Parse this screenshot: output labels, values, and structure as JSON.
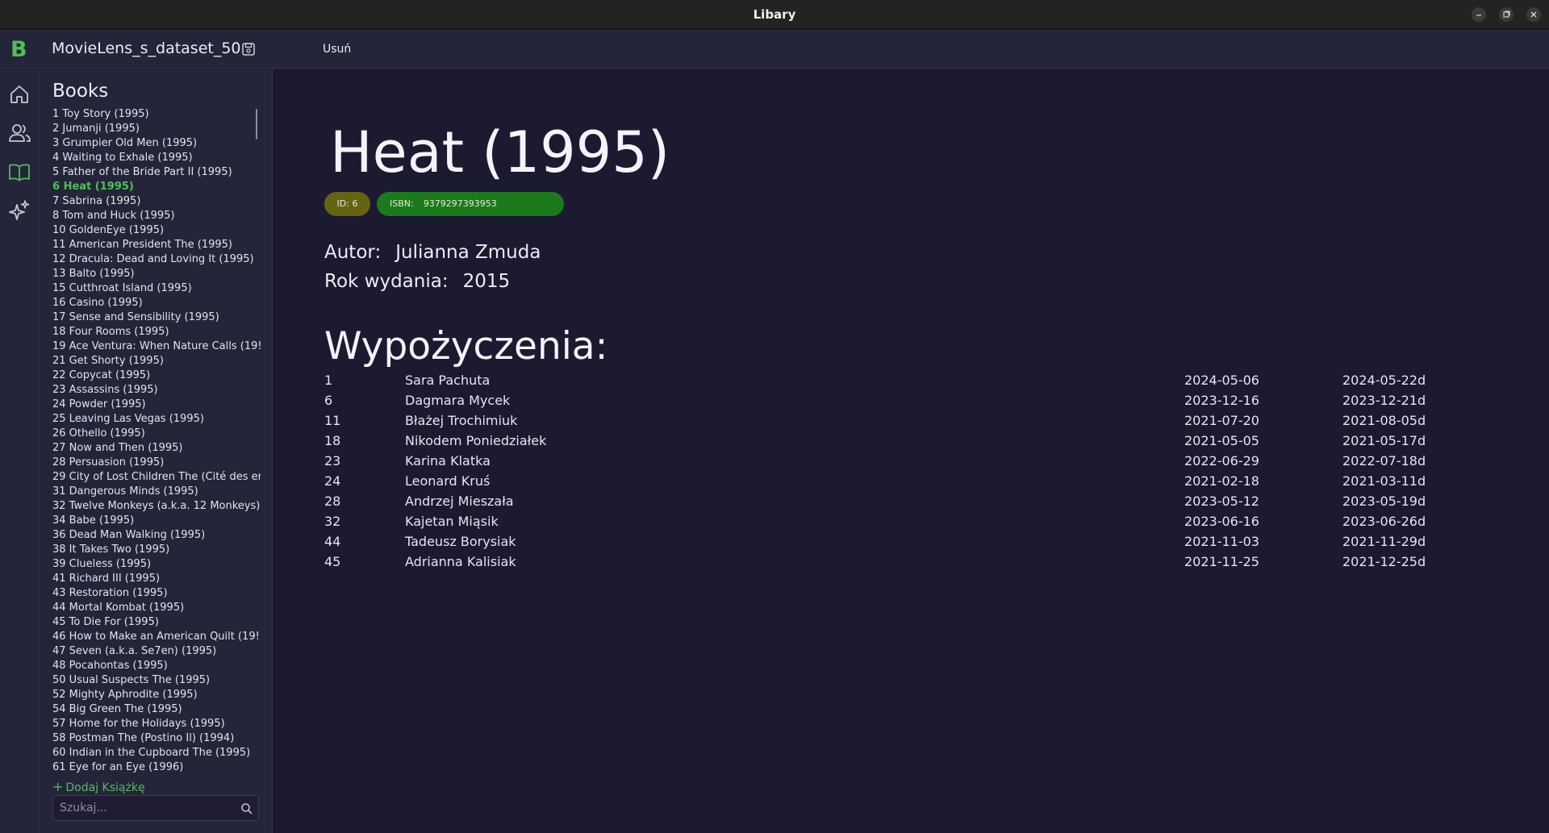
{
  "window": {
    "title": "Libary"
  },
  "header": {
    "logo": "B",
    "dataset_name": "MovieLens_s_dataset_50",
    "delete_label": "Usuń"
  },
  "sidebar": {
    "title": "Books",
    "add_label": "Dodaj Książkę",
    "search_placeholder": "Szukaj...",
    "active_index": 5,
    "books": [
      "1 Toy Story (1995)",
      "2 Jumanji (1995)",
      "3 Grumpier Old Men (1995)",
      "4 Waiting to Exhale (1995)",
      "5 Father of the Bride Part II (1995)",
      "6 Heat (1995)",
      "7 Sabrina (1995)",
      "8 Tom and Huck (1995)",
      "10 GoldenEye (1995)",
      "11 American President The (1995)",
      "12 Dracula: Dead and Loving It (1995)",
      "13 Balto (1995)",
      "15 Cutthroat Island (1995)",
      "16 Casino (1995)",
      "17 Sense and Sensibility (1995)",
      "18 Four Rooms (1995)",
      "19 Ace Ventura: When Nature Calls (19!",
      "21 Get Shorty (1995)",
      "22 Copycat (1995)",
      "23 Assassins (1995)",
      "24 Powder (1995)",
      "25 Leaving Las Vegas (1995)",
      "26 Othello (1995)",
      "27 Now and Then (1995)",
      "28 Persuasion (1995)",
      "29 City of Lost Children The (Cité des er",
      "31 Dangerous Minds (1995)",
      "32 Twelve Monkeys (a.k.a. 12 Monkeys)",
      "34 Babe (1995)",
      "36 Dead Man Walking (1995)",
      "38 It Takes Two (1995)",
      "39 Clueless (1995)",
      "41 Richard III (1995)",
      "43 Restoration (1995)",
      "44 Mortal Kombat (1995)",
      "45 To Die For (1995)",
      "46 How to Make an American Quilt (19!",
      "47 Seven (a.k.a. Se7en) (1995)",
      "48 Pocahontas (1995)",
      "50 Usual Suspects The (1995)",
      "52 Mighty Aphrodite (1995)",
      "54 Big Green The (1995)",
      "57 Home for the Holidays (1995)",
      "58 Postman The (Postino Il) (1994)",
      "60 Indian in the Cupboard The (1995)",
      "61 Eye for an Eye (1996)"
    ]
  },
  "book": {
    "title": "Heat (1995)",
    "id_badge": "ID: 6",
    "isbn_label": "ISBN:",
    "isbn_value": "9379297393953",
    "author_label": "Autor:",
    "author_value": "Julianna Zmuda",
    "year_label": "Rok wydania:",
    "year_value": "2015"
  },
  "loans": {
    "title": "Wypożyczenia:",
    "rows": [
      {
        "id": "1",
        "name": "Sara Pachuta",
        "from": "2024-05-06",
        "to": "2024-05-22d"
      },
      {
        "id": "6",
        "name": "Dagmara Mycek",
        "from": "2023-12-16",
        "to": "2023-12-21d"
      },
      {
        "id": "11",
        "name": "Błażej Trochimiuk",
        "from": "2021-07-20",
        "to": "2021-08-05d"
      },
      {
        "id": "18",
        "name": "Nikodem Poniedziałek",
        "from": "2021-05-05",
        "to": "2021-05-17d"
      },
      {
        "id": "23",
        "name": "Karina Klatka",
        "from": "2022-06-29",
        "to": "2022-07-18d"
      },
      {
        "id": "24",
        "name": "Leonard Kruś",
        "from": "2021-02-18",
        "to": "2021-03-11d"
      },
      {
        "id": "28",
        "name": "Andrzej Mieszała",
        "from": "2023-05-12",
        "to": "2023-05-19d"
      },
      {
        "id": "32",
        "name": "Kajetan Miąsik",
        "from": "2023-06-16",
        "to": "2023-06-26d"
      },
      {
        "id": "44",
        "name": "Tadeusz Borysiak",
        "from": "2021-11-03",
        "to": "2021-11-29d"
      },
      {
        "id": "45",
        "name": "Adrianna Kalisiak",
        "from": "2021-11-25",
        "to": "2021-12-25d"
      }
    ]
  },
  "icons": {
    "rail": [
      "home-icon",
      "users-icon",
      "book-icon",
      "sparkles-icon"
    ],
    "active_rail": "book-icon"
  },
  "colors": {
    "accent_green": "#4fbf57",
    "id_badge": "#666414",
    "isbn_badge": "#1c7a1c",
    "background": "#1b1a30",
    "panel": "#252539"
  }
}
